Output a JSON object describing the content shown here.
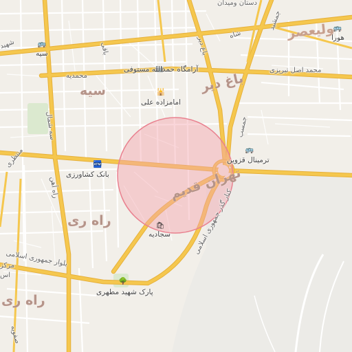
{
  "map": {
    "area_labels": {
      "seh": "سیه",
      "bagh_dir": "باغ دیر",
      "tehran_ghadim": "تهران قدیم",
      "rah_ray": "راه ری",
      "rah_ray_2": "راه ری",
      "valiasr": "ولیعصر"
    },
    "road_labels": {
      "top_bank": "دستان ومیدان",
      "shahid_left": "شهید",
      "shah": "شاه",
      "mohammadieh": "محمدیه",
      "mohammad_asl": "محمد اصل تبریزی",
      "jamshid": "جمشید",
      "baghi": "باقی",
      "bagh_dir_road": "باغ دیر",
      "montazeri": "منتظری",
      "seh_shomal": "سه شمال",
      "rah_ahan": "راه آهن",
      "jomhuri_left": "بلوار جمهوری اسلامی",
      "jomhuri_diag": "کنار گذر جمهوری اسلامی",
      "jamasb": "جمسب",
      "markaz": "مرکز",
      "es": "اس",
      "safavi": "صفویه"
    },
    "poi_labels": {
      "seh_poi": "سیه",
      "hamdollah": "آرامگاه حمدالله مستوفی",
      "imamzadeh": "امامزاده علی",
      "terminal": "ترمینال قزوین",
      "bank": "بانک کشاورزی",
      "sajadieh": "سجادیه",
      "park": "پارک شهید مطهری",
      "hora": "هورا"
    },
    "icons": {
      "bus_top": "bus-icon",
      "bus_terminal": "bus-icon",
      "bus_hora": "bus-icon",
      "camera": "camera-icon",
      "shrine": "shrine-icon",
      "bank": "atm-icon",
      "shop": "shop-icon",
      "park": "tree-icon"
    },
    "colors": {
      "land": "#f2efe9",
      "major_road": "#f5c74e",
      "major_road_edge": "#e6b03a",
      "minor_road": "#ffffff",
      "highlight_fill": "#f3a3ad",
      "highlight_stroke": "#e9818f"
    }
  }
}
